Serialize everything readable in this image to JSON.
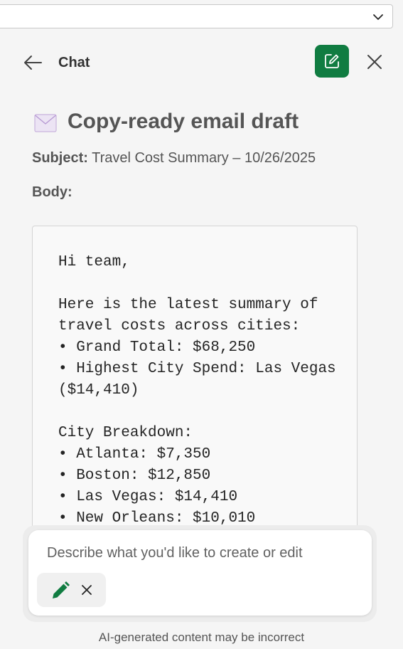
{
  "header": {
    "title": "Chat"
  },
  "draft": {
    "title": "Copy-ready email draft",
    "subject_label": "Subject:",
    "subject_value": "Travel Cost Summary – 10/26/2025",
    "body_label": "Body:",
    "body_text": "Hi team,\n\nHere is the latest summary of travel costs across cities:\n• Grand Total: $68,250\n• Highest City Spend: Las Vegas ($14,410)\n\nCity Breakdown:\n• Atlanta: $7,350\n• Boston: $12,850\n• Las Vegas: $14,410\n• New Orleans: $10,010"
  },
  "composer": {
    "placeholder": "Describe what you'd like to create or edit"
  },
  "footer": {
    "disclaimer": "AI-generated content may be incorrect"
  },
  "colors": {
    "accent": "#107c41",
    "background": "#f5f5f5"
  },
  "icons": [
    "chevron-down-icon",
    "back-arrow-icon",
    "compose-icon",
    "close-icon",
    "envelope-icon",
    "pencil-icon"
  ]
}
